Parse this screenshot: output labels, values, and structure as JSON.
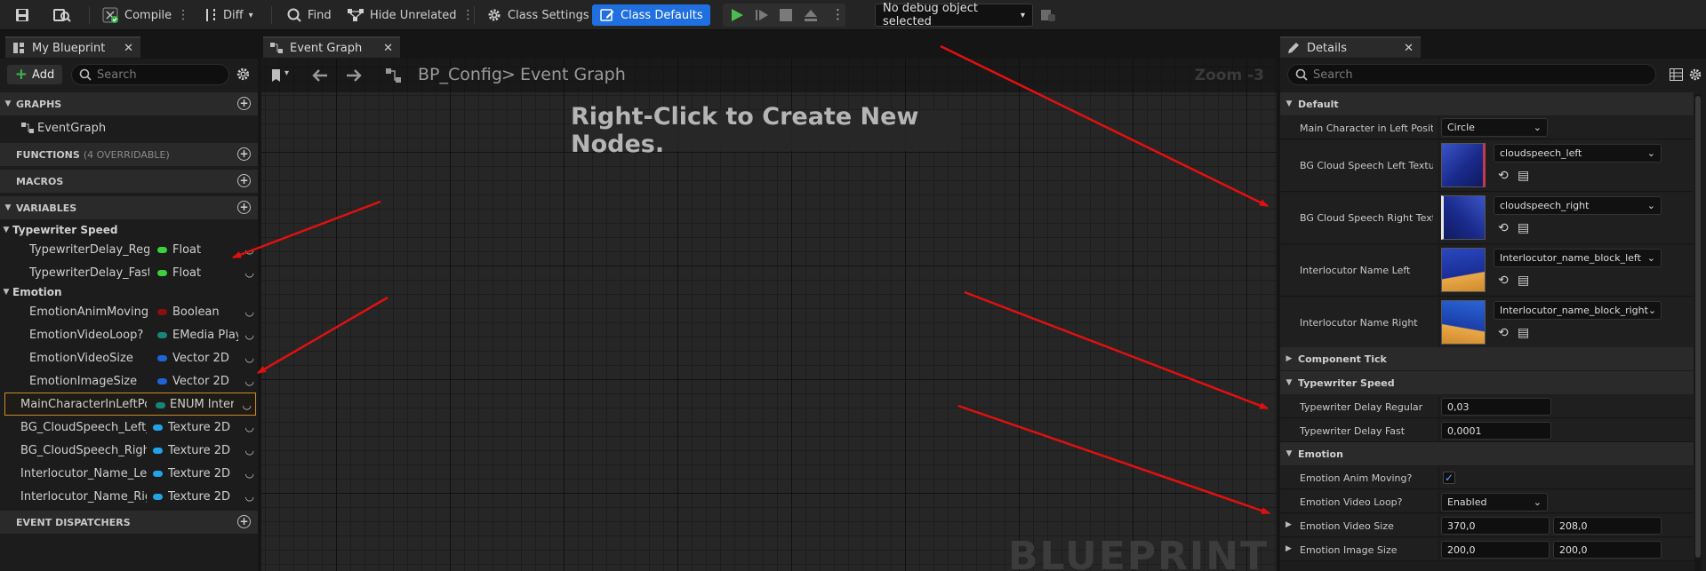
{
  "toolbar": {
    "compile": "Compile",
    "diff": "Diff",
    "find": "Find",
    "hide_unrelated": "Hide Unrelated",
    "class_settings": "Class Settings",
    "class_defaults": "Class Defaults",
    "debug_object": "No debug object selected"
  },
  "left_panel": {
    "tab_title": "My Blueprint",
    "add_label": "Add",
    "search_placeholder": "Search",
    "graphs_label": "GRAPHS",
    "event_graph": "EventGraph",
    "functions_label": "FUNCTIONS",
    "functions_note": "(4 OVERRIDABLE)",
    "macros_label": "MACROS",
    "variables_label": "VARIABLES",
    "categories": {
      "typewriter": "Typewriter Speed",
      "emotion": "Emotion"
    },
    "variables": [
      {
        "name": "TypewriterDelay_Regular",
        "type": "Float",
        "color": "#3bd13b"
      },
      {
        "name": "TypewriterDelay_Fast",
        "type": "Float",
        "color": "#3bd13b"
      },
      {
        "name": "EmotionAnimMoving?",
        "type": "Boolean",
        "color": "#8c0e0e"
      },
      {
        "name": "EmotionVideoLoop?",
        "type": "EMedia Playback",
        "color": "#14867a"
      },
      {
        "name": "EmotionVideoSize",
        "type": "Vector 2D",
        "color": "#1f63d6"
      },
      {
        "name": "EmotionImageSize",
        "type": "Vector 2D",
        "color": "#1f63d6"
      },
      {
        "name": "MainCharacterInLeftPosition",
        "type": "ENUM Interlocutor",
        "color": "#14867a"
      },
      {
        "name": "BG_CloudSpeech_Left_Texture",
        "type": "Texture 2D",
        "color": "#22a3e8"
      },
      {
        "name": "BG_CloudSpeech_Right_Texture",
        "type": "Texture 2D",
        "color": "#22a3e8"
      },
      {
        "name": "Interlocutor_Name_Left",
        "type": "Texture 2D",
        "color": "#22a3e8"
      },
      {
        "name": "Interlocutor_Name_Right",
        "type": "Texture 2D",
        "color": "#22a3e8"
      }
    ],
    "event_dispatchers_label": "EVENT DISPATCHERS"
  },
  "graph": {
    "tab_title": "Event Graph",
    "breadcrumb_root": "BP_Config",
    "breadcrumb_sep": ">",
    "breadcrumb_leaf": "Event Graph",
    "zoom": "Zoom -3",
    "hint": "Right-Click to Create New Nodes.",
    "watermark": "BLUEPRINT"
  },
  "details": {
    "tab_title": "Details",
    "search_placeholder": "Search",
    "section_default": "Default",
    "main_char_label": "Main Character in Left Position",
    "main_char_value": "Circle",
    "bg_left_label": "BG Cloud Speech Left Texture",
    "bg_left_value": "cloudspeech_left",
    "bg_right_label": "BG Cloud Speech Right Texture",
    "bg_right_value": "cloudspeech_right",
    "name_left_label": "Interlocutor Name Left",
    "name_left_value": "Interlocutor_name_block_left",
    "name_right_label": "Interlocutor Name Right",
    "name_right_value": "Interlocutor_name_block_right",
    "section_component_tick": "Component Tick",
    "section_typewriter": "Typewriter Speed",
    "delay_regular_label": "Typewriter Delay Regular",
    "delay_regular_value": "0,03",
    "delay_fast_label": "Typewriter Delay Fast",
    "delay_fast_value": "0,0001",
    "section_emotion": "Emotion",
    "anim_moving_label": "Emotion Anim Moving?",
    "video_loop_label": "Emotion Video Loop?",
    "video_loop_value": "Enabled",
    "video_size_label": "Emotion Video Size",
    "video_size_x": "370,0",
    "video_size_y": "208,0",
    "image_size_label": "Emotion Image Size",
    "image_size_x": "200,0",
    "image_size_y": "200,0"
  },
  "colors": {
    "accent": "#1f6fe0",
    "annotation_arrow": "#e01010",
    "selection_border": "#c88a2a"
  }
}
